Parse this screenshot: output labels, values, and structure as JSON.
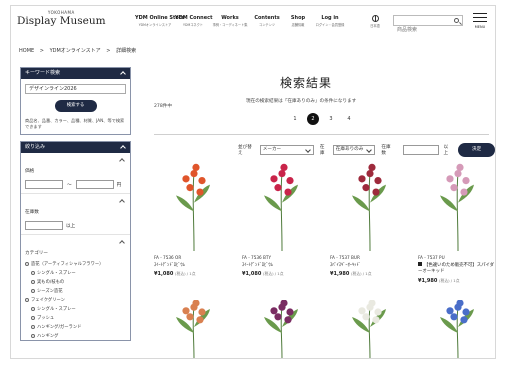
{
  "header": {
    "logo_small": "YOKOHAMA",
    "logo_big": "Display Museum",
    "nav": [
      {
        "title": "YDM Online Store",
        "sub": "YDMオンラインストア"
      },
      {
        "title": "YDM Connect",
        "sub": "YDMコネクト"
      },
      {
        "title": "Works",
        "sub": "事例・コーディネート集"
      },
      {
        "title": "Contents",
        "sub": "コンテンツ"
      },
      {
        "title": "Shop",
        "sub": "店舗情報"
      },
      {
        "title": "Log in",
        "sub": "ログイン・会員登録"
      }
    ],
    "lang_label": "日本語",
    "search_placeholder": "商品検索",
    "menu_label": "MENU"
  },
  "breadcrumb": [
    "HOME",
    ">",
    "YDMオンラインストア",
    ">",
    "詳細検索"
  ],
  "sidebar": {
    "keyword": {
      "heading": "キーワード検索",
      "value": "デザインライン2026",
      "button": "検索する",
      "note": "商品名、品番、カラー、品種、材質、JAN、等で検索できます"
    },
    "filter": {
      "heading": "絞り込み",
      "price_label": "価格",
      "price_unit": "円",
      "tilde": "〜",
      "stock_label": "在庫数",
      "stock_unit": "以上",
      "category_label": "カテゴリー",
      "categories": [
        {
          "label": "造花（アーティフィシャルフラワー）",
          "level": 0
        },
        {
          "label": "シングル・スプレー",
          "level": 1
        },
        {
          "label": "実もの/枝もの",
          "level": 1
        },
        {
          "label": "シーズン造花",
          "level": 1
        },
        {
          "label": "フェイクグリーン",
          "level": 0
        },
        {
          "label": "シングル・スプレー",
          "level": 1
        },
        {
          "label": "ブッシュ",
          "level": 1
        },
        {
          "label": "ハンギング/ガーランド",
          "level": 1
        },
        {
          "label": "ハンギング",
          "level": 1
        },
        {
          "label": "アウトレットアイテム",
          "level": 0
        }
      ]
    }
  },
  "main": {
    "title": "検索結果",
    "result_count": "278件中",
    "message": "現在の検索結果は「在庫ありのみ」の条件になります",
    "pages": [
      "1",
      "2",
      "3",
      "4"
    ],
    "active_page": "2",
    "sort_label": "並び替え",
    "sort_value": "メーカー",
    "stock_filter_label": "在庫",
    "stock_filter_value": "在庫ありのみ",
    "stock_count_label": "在庫数",
    "stock_count_unit": "以上",
    "go_button": "決定",
    "products": [
      {
        "code": "FA - 7536 OR",
        "name": "ｽｲｰﾄﾃﾞﾝﾄﾞﾛﾋﾞｳﾑ",
        "price": "¥1,080",
        "tax": "(税込) / 1点",
        "flower": "#e0552b"
      },
      {
        "code": "FA - 7536 BTY",
        "name": "ｽｲｰﾄﾃﾞﾝﾄﾞﾛﾋﾞｳﾑ",
        "price": "¥1,080",
        "tax": "(税込) / 1点",
        "flower": "#c9244a"
      },
      {
        "code": "FA - 7537 BUR",
        "name": "ｽﾊﾟｲｽｷﾞｰｵｰｷｯﾄﾞ",
        "price": "¥1,980",
        "tax": "(税込) / 1点",
        "flower": "#9e2a3c"
      },
      {
        "code": "FA - 7537 PU",
        "note": "【色違いのため販売不可】スパイダーオーキッド",
        "price": "¥1,980",
        "tax": "(税込) / 1点",
        "flower": "#d59ab8"
      }
    ],
    "row2_flowers": [
      "#d98050",
      "#7a2c62",
      "#e9e9e0",
      "#4a6ec9"
    ]
  }
}
